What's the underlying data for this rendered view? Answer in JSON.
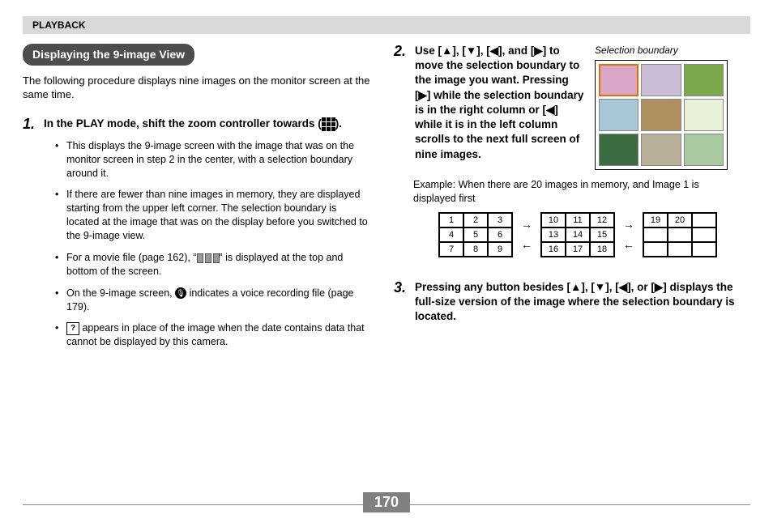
{
  "header": "PLAYBACK",
  "section_title": "Displaying the 9-image View",
  "intro": "The following procedure displays nine images on the monitor screen at the same time.",
  "step1": {
    "num": "1.",
    "text_a": "In the PLAY mode, shift the zoom controller towards (",
    "text_b": ").",
    "bullets": [
      "This displays the 9-image screen with the image that was on the monitor screen in step 2 in the center, with a selection boundary around it.",
      "If there are fewer than nine images in memory, they are displayed starting from the upper left corner. The selection boundary is located at the image that was on the display before you switched to the 9-image view.",
      {
        "a": "For a movie file (page 162), “",
        "b": "” is displayed at the top and bottom of the screen."
      },
      {
        "a": "On the 9-image screen, ",
        "b": " indicates a voice recording file (page 179)."
      },
      {
        "a": "",
        "b": " appears in place of the image when the date contains data that cannot be displayed by this camera."
      }
    ]
  },
  "step2": {
    "num": "2.",
    "text": "Use [▲], [▼], [◀], and [▶] to move the selection boundary to the image you want. Pressing [▶] while the selection boundary is in the right column or [◀] while it is in the left column scrolls to the next full screen of nine images.",
    "caption": "Selection boundary",
    "example": "Example: When there are 20 images in memory, and Image 1 is displayed first",
    "grid1": [
      "1",
      "2",
      "3",
      "4",
      "5",
      "6",
      "7",
      "8",
      "9"
    ],
    "grid2": [
      "10",
      "11",
      "12",
      "13",
      "14",
      "15",
      "16",
      "17",
      "18"
    ],
    "grid3": [
      "19",
      "20",
      "",
      "",
      "",
      "",
      "",
      "",
      ""
    ]
  },
  "step3": {
    "num": "3.",
    "text": "Pressing any button besides [▲], [▼], [◀], or [▶] displays the full-size version of the image where the selection boundary is located."
  },
  "thumb_colors": [
    "#d8a7c8",
    "#c9bcd4",
    "#7aa84a",
    "#a7c6d6",
    "#b09060",
    "#e8f0d8",
    "#3a6a40",
    "#b8b098",
    "#a8c8a0"
  ],
  "page_number": "170"
}
